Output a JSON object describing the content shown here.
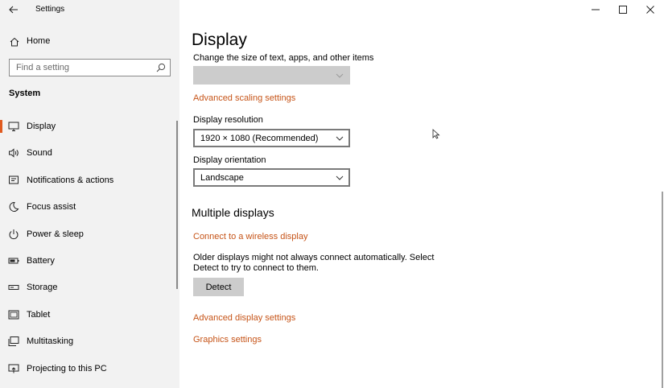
{
  "window": {
    "title": "Settings"
  },
  "sidebar": {
    "home_label": "Home",
    "search": {
      "placeholder": "Find a setting"
    },
    "section": "System",
    "items": [
      {
        "label": "Display",
        "icon": "monitor-icon",
        "active": true
      },
      {
        "label": "Sound",
        "icon": "speaker-icon"
      },
      {
        "label": "Notifications & actions",
        "icon": "notification-icon"
      },
      {
        "label": "Focus assist",
        "icon": "moon-icon"
      },
      {
        "label": "Power & sleep",
        "icon": "power-icon"
      },
      {
        "label": "Battery",
        "icon": "battery-icon"
      },
      {
        "label": "Storage",
        "icon": "storage-icon"
      },
      {
        "label": "Tablet",
        "icon": "tablet-icon"
      },
      {
        "label": "Multitasking",
        "icon": "multitasking-icon"
      },
      {
        "label": "Projecting to this PC",
        "icon": "projecting-icon"
      }
    ]
  },
  "main": {
    "title": "Display",
    "scale_label": "Change the size of text, apps, and other items",
    "scale_value": "",
    "advanced_scaling_link": "Advanced scaling settings",
    "resolution_label": "Display resolution",
    "resolution_value": "1920 × 1080 (Recommended)",
    "orientation_label": "Display orientation",
    "orientation_value": "Landscape",
    "multiple_displays_heading": "Multiple displays",
    "wireless_link": "Connect to a wireless display",
    "detect_desc": "Older displays might not always connect automatically. Select Detect to try to connect to them.",
    "detect_button": "Detect",
    "advanced_display_link": "Advanced display settings",
    "graphics_link": "Graphics settings"
  },
  "colors": {
    "accent": "#e05a1f",
    "link": "#c65418",
    "sidebar_bg": "#f2f2f2"
  }
}
